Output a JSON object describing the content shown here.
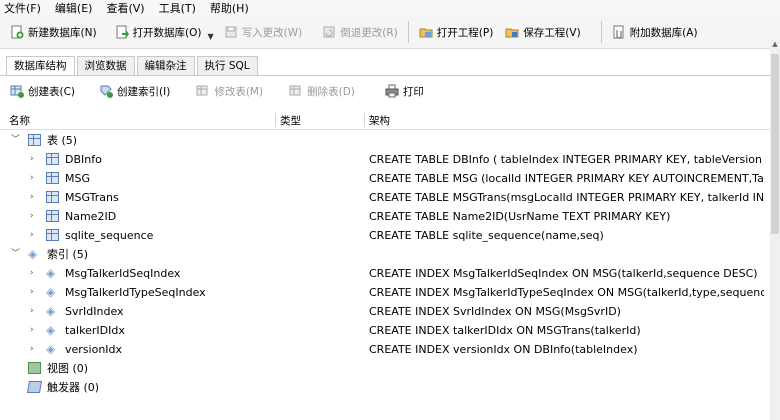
{
  "menu": [
    "文件(F)",
    "编辑(E)",
    "查看(V)",
    "工具(T)",
    "帮助(H)"
  ],
  "toolbar": {
    "new_db": "新建数据库(N)",
    "open_db": "打开数据库(O)",
    "write_changes": "写入更改(W)",
    "revert_changes": "倒退更改(R)",
    "open_project": "打开工程(P)",
    "save_project": "保存工程(V)",
    "attach_db": "附加数据库(A)"
  },
  "tabs": [
    "数据库结构",
    "浏览数据",
    "编辑杂注",
    "执行 SQL"
  ],
  "actions": {
    "create_table": "创建表(C)",
    "create_index": "创建索引(I)",
    "modify_table": "修改表(M)",
    "delete_table": "删除表(D)",
    "print": "打印"
  },
  "columns": {
    "name": "名称",
    "type": "类型",
    "schema": "架构"
  },
  "tree": {
    "tables_label": "表 (5)",
    "tables": [
      {
        "name": "DBInfo",
        "schema": "CREATE TABLE DBInfo ( tableIndex INTEGER PRIMARY KEY, tableVersion IN"
      },
      {
        "name": "MSG",
        "schema": "CREATE TABLE MSG (localId INTEGER PRIMARY KEY AUTOINCREMENT,Tal"
      },
      {
        "name": "MSGTrans",
        "schema": "CREATE TABLE MSGTrans(msgLocalId INTEGER PRIMARY KEY, talkerId INT"
      },
      {
        "name": "Name2ID",
        "schema": "CREATE TABLE Name2ID(UsrName TEXT PRIMARY KEY)"
      },
      {
        "name": "sqlite_sequence",
        "schema": "CREATE TABLE sqlite_sequence(name,seq)"
      }
    ],
    "indexes_label": "索引 (5)",
    "indexes": [
      {
        "name": "MsgTalkerIdSeqIndex",
        "schema": "CREATE INDEX MsgTalkerIdSeqIndex ON MSG(talkerId,sequence DESC)"
      },
      {
        "name": "MsgTalkerIdTypeSeqIndex",
        "schema": "CREATE INDEX MsgTalkerIdTypeSeqIndex ON MSG(talkerId,type,sequence"
      },
      {
        "name": "SvrIdIndex",
        "schema": "CREATE INDEX SvrIdIndex ON MSG(MsgSvrID)"
      },
      {
        "name": "talkerIDIdx",
        "schema": "CREATE INDEX talkerIDIdx ON MSGTrans(talkerId)"
      },
      {
        "name": "versionIdx",
        "schema": "CREATE INDEX versionIdx ON DBInfo(tableIndex)"
      }
    ],
    "views_label": "视图 (0)",
    "triggers_label": "触发器 (0)"
  }
}
